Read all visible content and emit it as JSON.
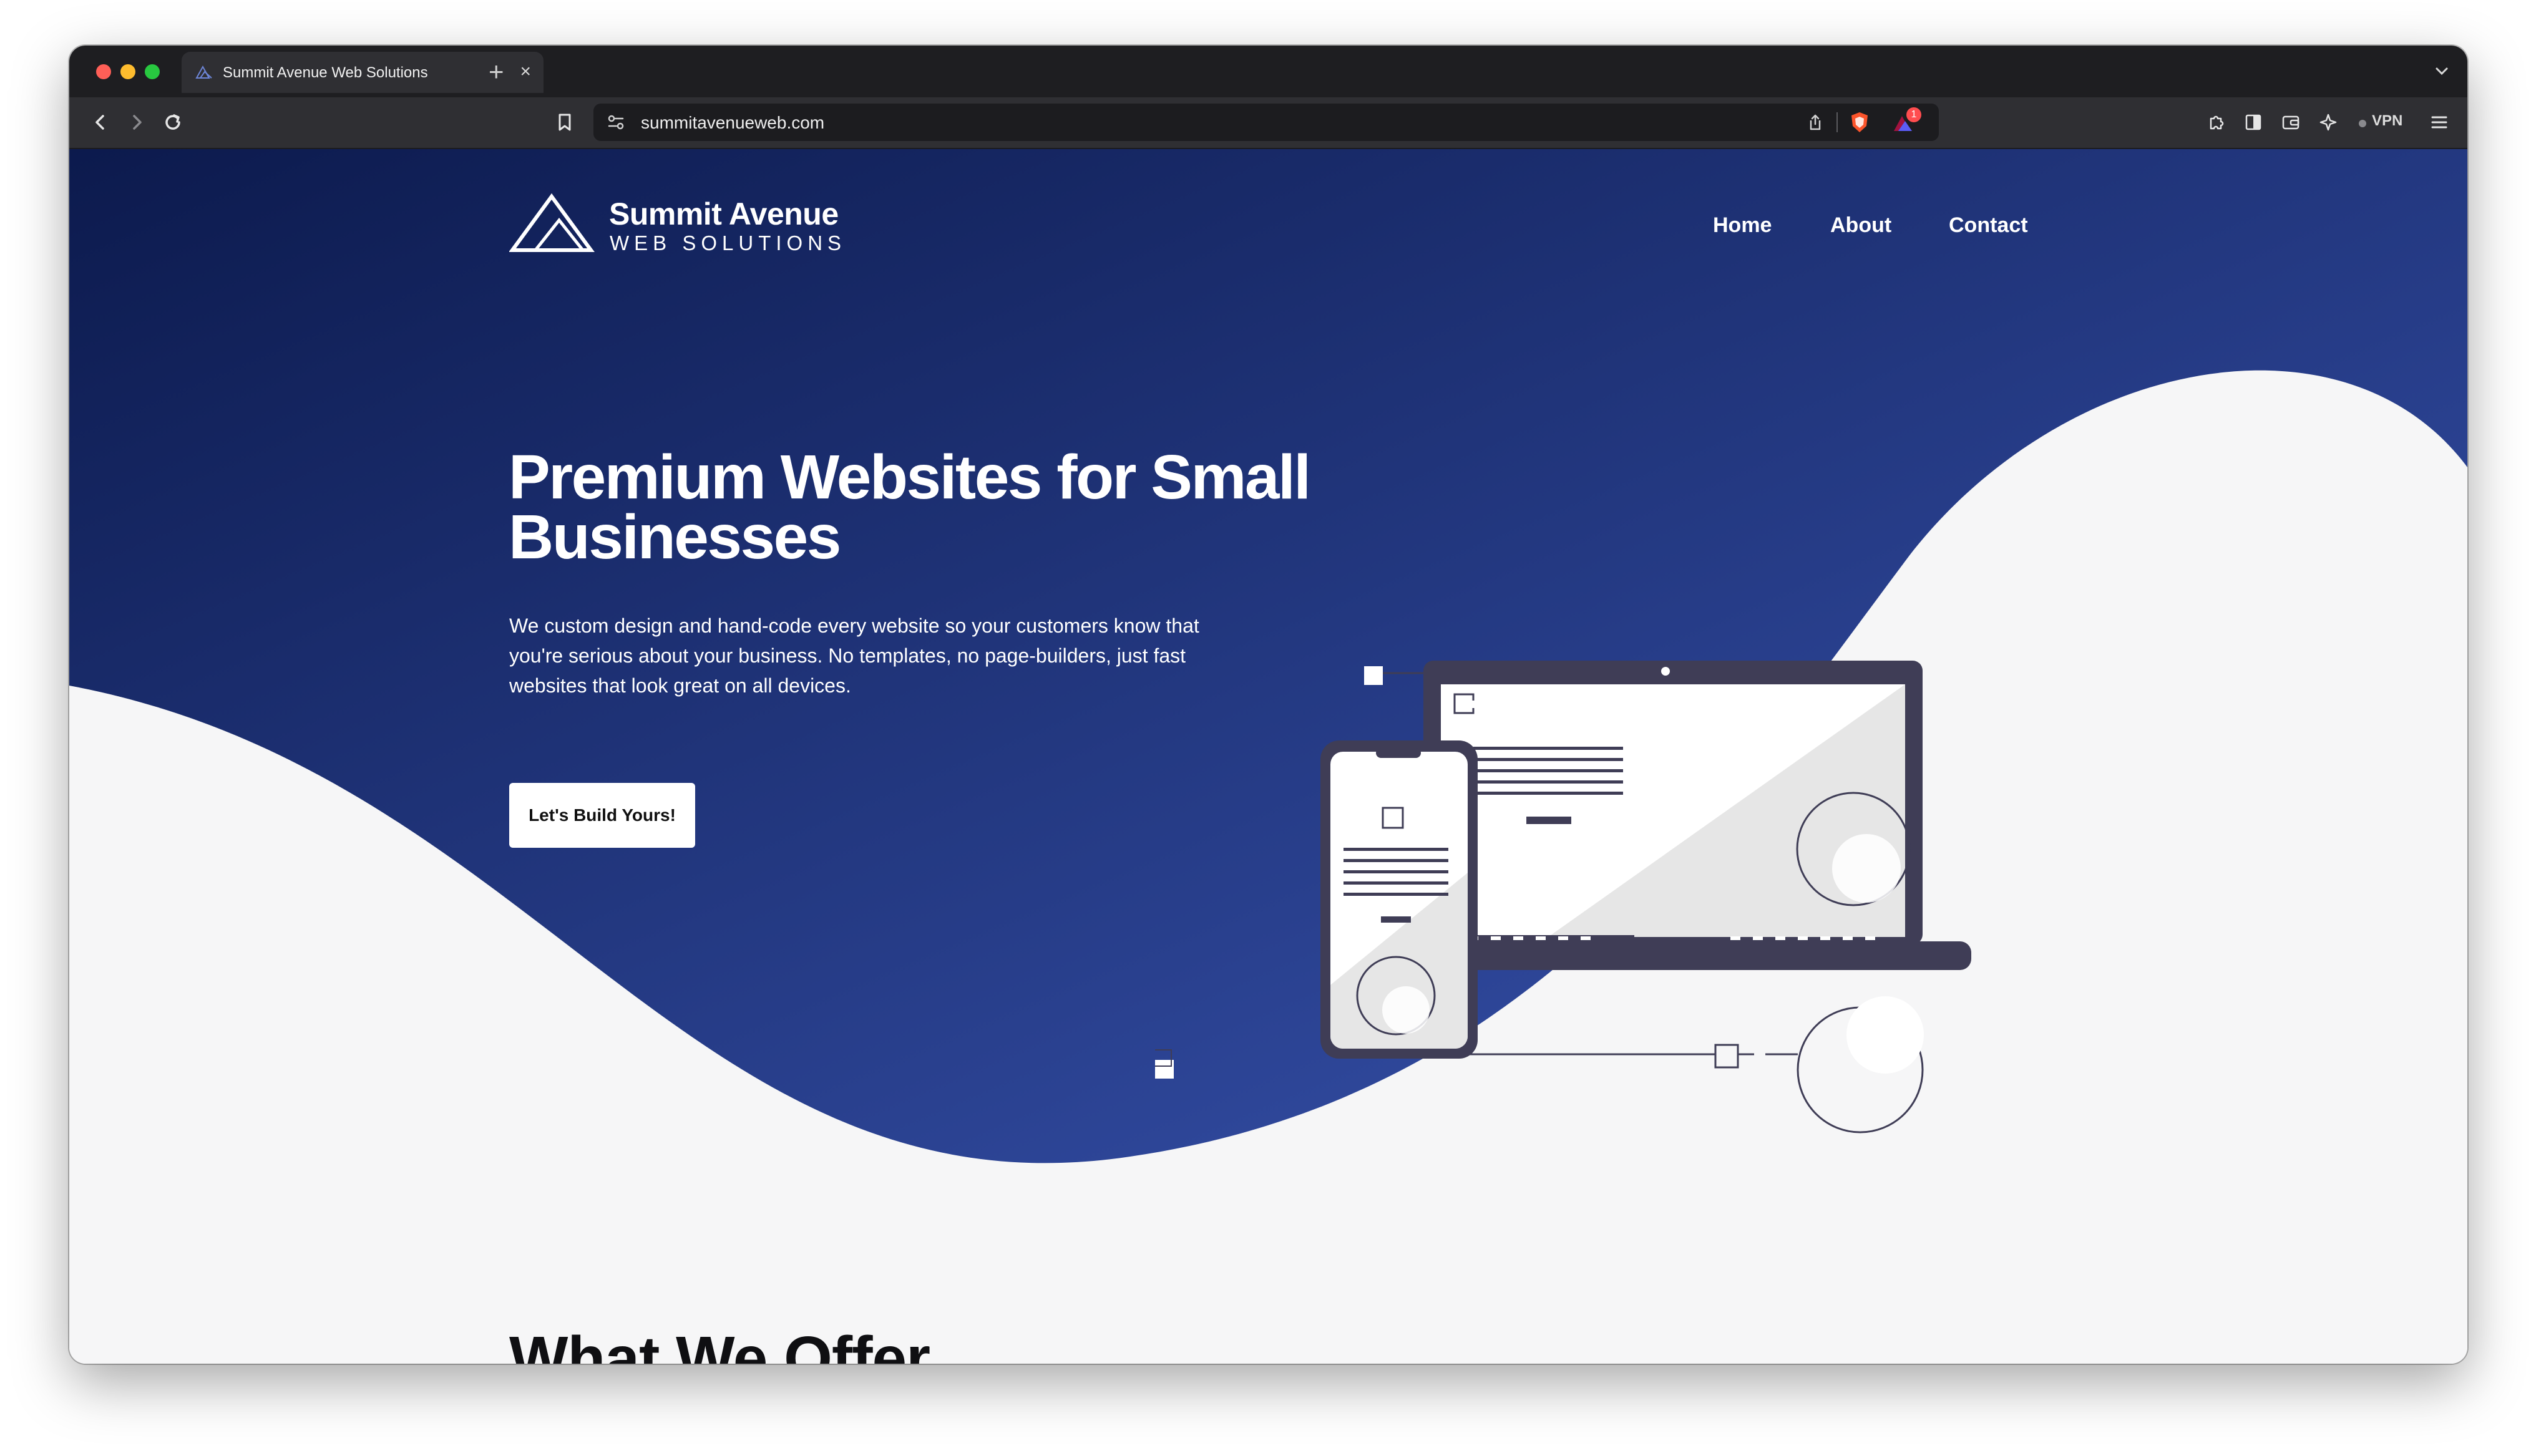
{
  "browser": {
    "tab_title": "Summit Avenue Web Solutions",
    "tab_close": "×",
    "new_tab": "+",
    "url": "summitavenueweb.com",
    "vpn_label": "VPN",
    "shield_notification_count": "1"
  },
  "site": {
    "brand_name": "Summit Avenue",
    "brand_tagline": "WEB SOLUTIONS",
    "nav": [
      "Home",
      "About",
      "Contact"
    ],
    "hero": {
      "title": "Premium Websites for Small Businesses",
      "text": "We custom design and hand-code every website so your customers know that you're serious about your business. No templates, no page-builders, just fast websites that look great on all devices.",
      "cta": "Let's Build Yours!"
    },
    "section_title": "What We Offer"
  },
  "colors": {
    "hero_gradient_start": "#0c1a4d",
    "hero_gradient_end": "#3a56b4",
    "device_dark": "#3f3d56",
    "page_bg": "#f6f6f7",
    "browser_chrome": "#2f2f33"
  }
}
